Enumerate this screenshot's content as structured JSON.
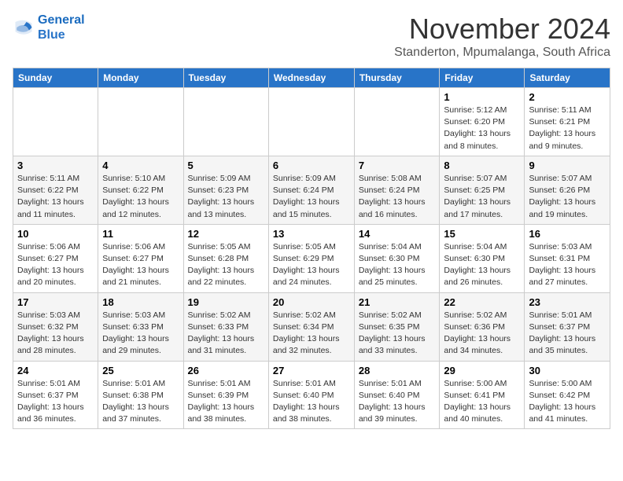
{
  "header": {
    "logo_line1": "General",
    "logo_line2": "Blue",
    "month": "November 2024",
    "location": "Standerton, Mpumalanga, South Africa"
  },
  "days_of_week": [
    "Sunday",
    "Monday",
    "Tuesday",
    "Wednesday",
    "Thursday",
    "Friday",
    "Saturday"
  ],
  "weeks": [
    [
      {
        "day": "",
        "info": ""
      },
      {
        "day": "",
        "info": ""
      },
      {
        "day": "",
        "info": ""
      },
      {
        "day": "",
        "info": ""
      },
      {
        "day": "",
        "info": ""
      },
      {
        "day": "1",
        "info": "Sunrise: 5:12 AM\nSunset: 6:20 PM\nDaylight: 13 hours and 8 minutes."
      },
      {
        "day": "2",
        "info": "Sunrise: 5:11 AM\nSunset: 6:21 PM\nDaylight: 13 hours and 9 minutes."
      }
    ],
    [
      {
        "day": "3",
        "info": "Sunrise: 5:11 AM\nSunset: 6:22 PM\nDaylight: 13 hours and 11 minutes."
      },
      {
        "day": "4",
        "info": "Sunrise: 5:10 AM\nSunset: 6:22 PM\nDaylight: 13 hours and 12 minutes."
      },
      {
        "day": "5",
        "info": "Sunrise: 5:09 AM\nSunset: 6:23 PM\nDaylight: 13 hours and 13 minutes."
      },
      {
        "day": "6",
        "info": "Sunrise: 5:09 AM\nSunset: 6:24 PM\nDaylight: 13 hours and 15 minutes."
      },
      {
        "day": "7",
        "info": "Sunrise: 5:08 AM\nSunset: 6:24 PM\nDaylight: 13 hours and 16 minutes."
      },
      {
        "day": "8",
        "info": "Sunrise: 5:07 AM\nSunset: 6:25 PM\nDaylight: 13 hours and 17 minutes."
      },
      {
        "day": "9",
        "info": "Sunrise: 5:07 AM\nSunset: 6:26 PM\nDaylight: 13 hours and 19 minutes."
      }
    ],
    [
      {
        "day": "10",
        "info": "Sunrise: 5:06 AM\nSunset: 6:27 PM\nDaylight: 13 hours and 20 minutes."
      },
      {
        "day": "11",
        "info": "Sunrise: 5:06 AM\nSunset: 6:27 PM\nDaylight: 13 hours and 21 minutes."
      },
      {
        "day": "12",
        "info": "Sunrise: 5:05 AM\nSunset: 6:28 PM\nDaylight: 13 hours and 22 minutes."
      },
      {
        "day": "13",
        "info": "Sunrise: 5:05 AM\nSunset: 6:29 PM\nDaylight: 13 hours and 24 minutes."
      },
      {
        "day": "14",
        "info": "Sunrise: 5:04 AM\nSunset: 6:30 PM\nDaylight: 13 hours and 25 minutes."
      },
      {
        "day": "15",
        "info": "Sunrise: 5:04 AM\nSunset: 6:30 PM\nDaylight: 13 hours and 26 minutes."
      },
      {
        "day": "16",
        "info": "Sunrise: 5:03 AM\nSunset: 6:31 PM\nDaylight: 13 hours and 27 minutes."
      }
    ],
    [
      {
        "day": "17",
        "info": "Sunrise: 5:03 AM\nSunset: 6:32 PM\nDaylight: 13 hours and 28 minutes."
      },
      {
        "day": "18",
        "info": "Sunrise: 5:03 AM\nSunset: 6:33 PM\nDaylight: 13 hours and 29 minutes."
      },
      {
        "day": "19",
        "info": "Sunrise: 5:02 AM\nSunset: 6:33 PM\nDaylight: 13 hours and 31 minutes."
      },
      {
        "day": "20",
        "info": "Sunrise: 5:02 AM\nSunset: 6:34 PM\nDaylight: 13 hours and 32 minutes."
      },
      {
        "day": "21",
        "info": "Sunrise: 5:02 AM\nSunset: 6:35 PM\nDaylight: 13 hours and 33 minutes."
      },
      {
        "day": "22",
        "info": "Sunrise: 5:02 AM\nSunset: 6:36 PM\nDaylight: 13 hours and 34 minutes."
      },
      {
        "day": "23",
        "info": "Sunrise: 5:01 AM\nSunset: 6:37 PM\nDaylight: 13 hours and 35 minutes."
      }
    ],
    [
      {
        "day": "24",
        "info": "Sunrise: 5:01 AM\nSunset: 6:37 PM\nDaylight: 13 hours and 36 minutes."
      },
      {
        "day": "25",
        "info": "Sunrise: 5:01 AM\nSunset: 6:38 PM\nDaylight: 13 hours and 37 minutes."
      },
      {
        "day": "26",
        "info": "Sunrise: 5:01 AM\nSunset: 6:39 PM\nDaylight: 13 hours and 38 minutes."
      },
      {
        "day": "27",
        "info": "Sunrise: 5:01 AM\nSunset: 6:40 PM\nDaylight: 13 hours and 38 minutes."
      },
      {
        "day": "28",
        "info": "Sunrise: 5:01 AM\nSunset: 6:40 PM\nDaylight: 13 hours and 39 minutes."
      },
      {
        "day": "29",
        "info": "Sunrise: 5:00 AM\nSunset: 6:41 PM\nDaylight: 13 hours and 40 minutes."
      },
      {
        "day": "30",
        "info": "Sunrise: 5:00 AM\nSunset: 6:42 PM\nDaylight: 13 hours and 41 minutes."
      }
    ]
  ]
}
